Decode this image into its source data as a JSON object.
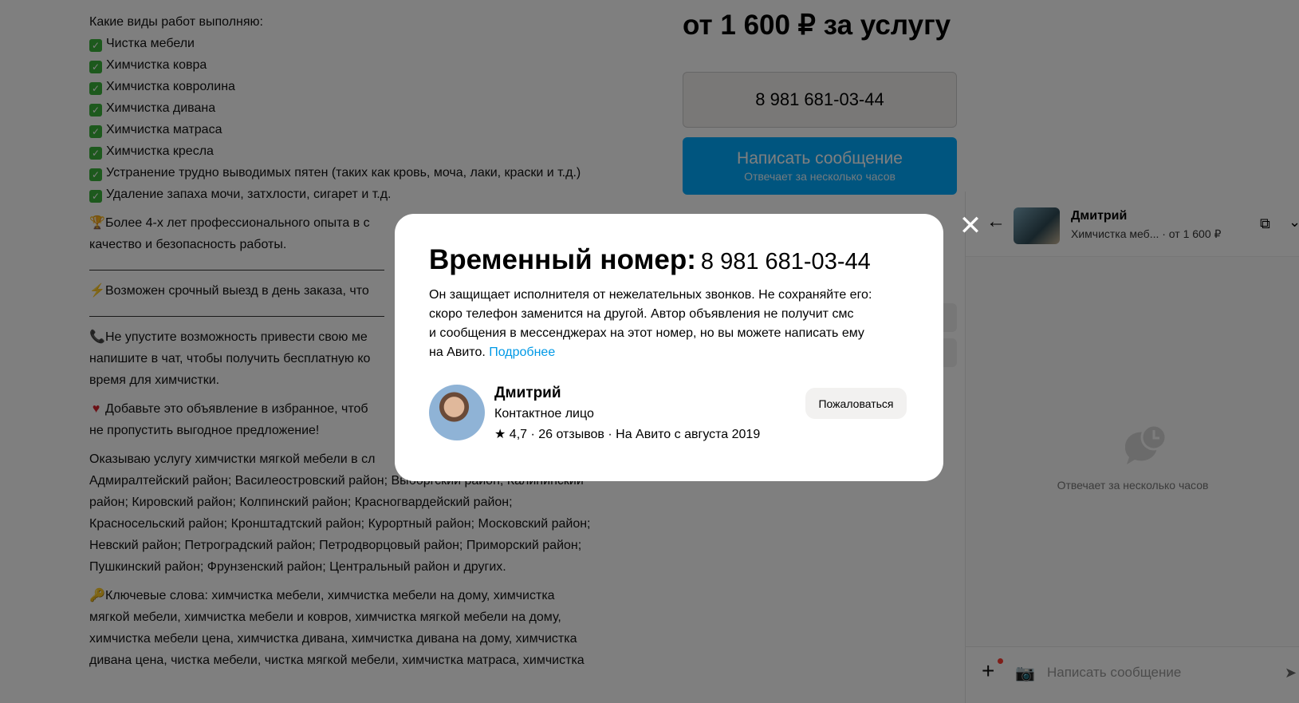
{
  "description": {
    "intro": "Какие виды работ выполняю:",
    "services": [
      "Чистка мебели",
      "Химчистка ковра",
      "Химчистка ковролина",
      "Химчистка дивана",
      "Химчистка матраса",
      "Химчистка кресла",
      "Устранение трудно выводимых пятен (таких как кровь, моча, лаки, краски и т.д.)",
      "Удаление запаха мочи, затхлости, сигарет и т.д."
    ],
    "experience_line1": "Более 4-х лет профессионального опыта в с",
    "experience_line2": "качество и безопасность работы.",
    "urgent": "Возможен срочный выезд в день заказа, что",
    "call_line1": "Не упустите возможность привести свою ме",
    "call_line2": "напишите в чат, чтобы получить бесплатную ко",
    "call_line3": "время для химчистки.",
    "fav_line1": "Добавьте это объявление в избранное, чтоб",
    "fav_line2": "не пропустить выгодное предложение!",
    "districts_line1": "Оказываю услугу химчистки мягкой мебели в сл",
    "districts_line2": "Адмиралтейский район; Василеостровский район; Выборгский район; Калининский",
    "districts_line3": "район; Кировский район; Колпинский район; Красногвардейский район;",
    "districts_line4": "Красносельский район; Кронштадтский район; Курортный район; Московский район;",
    "districts_line5": "Невский район; Петроградский район; Петродворцовый район; Приморский район;",
    "districts_line6": "Пушкинский район; Фрунзенский район; Центральный район и других.",
    "keywords_line1": "Ключевые слова: химчистка мебели, химчистка мебели на дому, химчистка",
    "keywords_line2": "мягкой мебели, химчистка мебели и ковров, химчистка мягкой мебели на дому,",
    "keywords_line3": "химчистка мебели цена, химчистка дивана, химчистка дивана на дому, химчистка",
    "keywords_line4": "дивана цена, чистка мебели, чистка мягкой мебели, химчистка матраса, химчистка"
  },
  "sidebar": {
    "price": "от 1 600 ₽ за услугу",
    "phone": "8 981 681-03-44",
    "write_button": "Написать сообщение",
    "write_button_sub": "Отвечает за несколько часов"
  },
  "chat": {
    "name": "Дмитрий",
    "subtitle": "Химчистка меб...  · от 1 600 ₽",
    "empty_text": "Отвечает за несколько часов",
    "input_placeholder": "Написать сообщение"
  },
  "modal": {
    "title": "Временный номер:",
    "number": "8 981 681-03-44",
    "text_line1": "Он защищает исполнителя от нежелательных звонков. Не сохраняйте его:",
    "text_line2": "скоро телефон заменится на другой. Автор объявления не получит смс",
    "text_line3": "и сообщения в мессенджерах на этот номер, но вы можете написать ему",
    "text_line4": "на Авито. ",
    "more_link": "Подробнее",
    "seller_name": "Дмитрий",
    "seller_role": "Контактное лицо",
    "seller_meta": "★ 4,7 · 26 отзывов · На Авито с августа 2019",
    "complain_button": "Пожаловаться",
    "close_label": "✕"
  },
  "colors": {
    "accent": "#00aaff",
    "link": "#0099e6",
    "check": "#3bb33b",
    "overlay": "rgba(0,0,0,0.5)"
  }
}
